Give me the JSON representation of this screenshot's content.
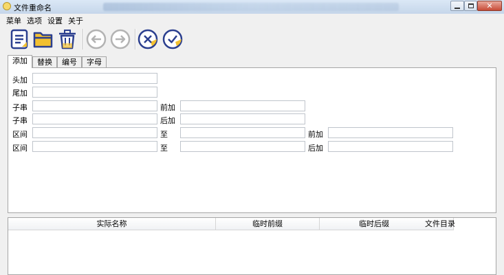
{
  "window": {
    "title": "文件重命名"
  },
  "menu": [
    "菜单",
    "选项",
    "设置",
    "关于"
  ],
  "toolbar": {
    "buttons": [
      {
        "name": "list-icon",
        "enabled": true
      },
      {
        "name": "folder-open-icon",
        "enabled": true
      },
      {
        "name": "trash-icon",
        "enabled": true
      },
      {
        "name": "back-arrow-icon",
        "enabled": false
      },
      {
        "name": "forward-arrow-icon",
        "enabled": false
      },
      {
        "name": "cancel-icon",
        "enabled": true
      },
      {
        "name": "confirm-icon",
        "enabled": true
      }
    ],
    "colors": {
      "primary": "#2b3f8f",
      "accent": "#f2c030",
      "disabled": "#b3b3b3"
    }
  },
  "tabs": [
    "添加",
    "替换",
    "编号",
    "字母"
  ],
  "active_tab": 0,
  "form": {
    "prefix": "头加",
    "suffix": "尾加",
    "substring": "子串",
    "before": "前加",
    "after": "后加",
    "range": "区间",
    "to": "至"
  },
  "table": {
    "columns": [
      "实际名称",
      "临时前缀",
      "临时后缀",
      "文件目录"
    ]
  }
}
